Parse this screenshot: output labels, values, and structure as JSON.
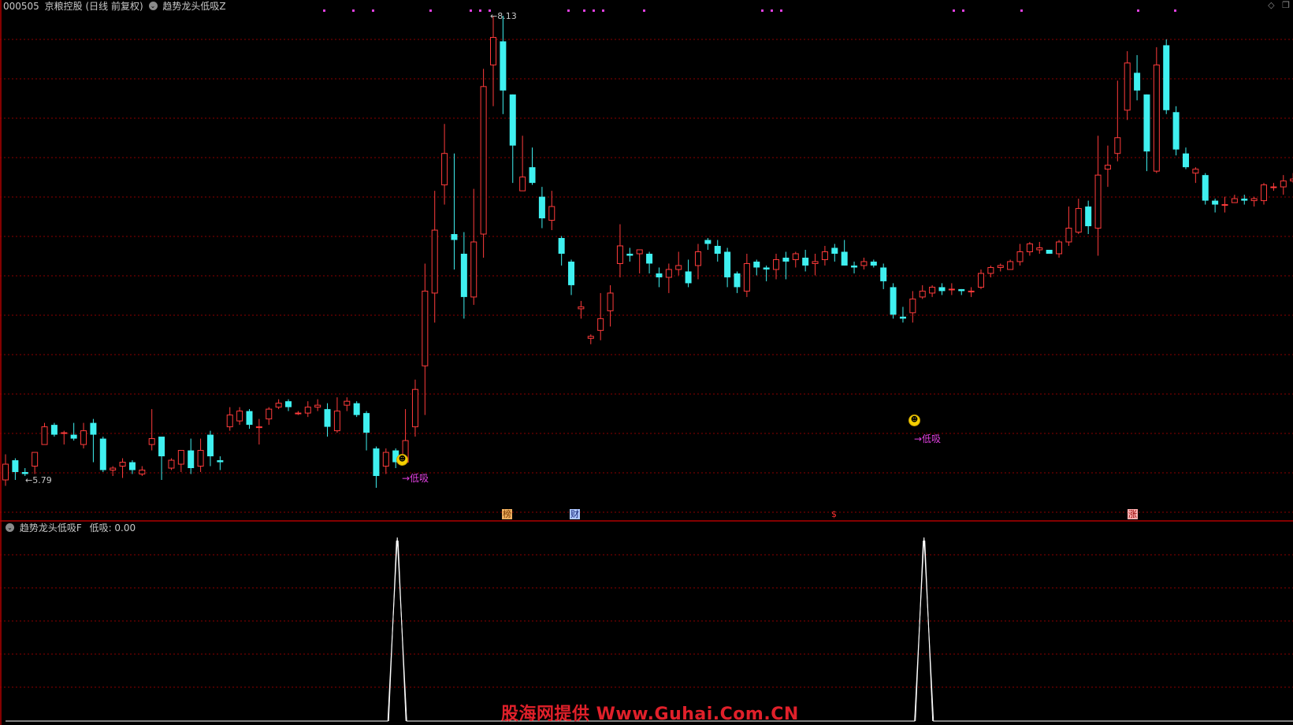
{
  "header": {
    "code": "000505",
    "name": "京粮控股",
    "period": "(日线 前复权)",
    "indicator": "趋势龙头低吸Z"
  },
  "sub_header": {
    "indicator": "趋势龙头低吸F",
    "value_label": "低吸: 0.00"
  },
  "top_right_icons": {
    "diamond": "◇",
    "window": "❐"
  },
  "price_labels": {
    "high": "8.13",
    "low": "5.79"
  },
  "signal_label": "→低吸",
  "event_tags": [
    "榜",
    "财",
    "$",
    "涨"
  ],
  "watermark": "股海网提供 Www.Guhai.Com.CN",
  "colors": {
    "up": "#ff3b3b",
    "down": "#3ff0f0",
    "grid": "#8b0000",
    "signal": "#e040e0",
    "divider": "#b00000"
  },
  "chart_data": {
    "type": "candlestick",
    "ylim": [
      5.55,
      8.3
    ],
    "candles": [
      [
        5.77,
        5.85,
        5.9,
        5.74
      ],
      [
        5.87,
        5.81,
        5.88,
        5.77
      ],
      [
        5.81,
        5.8,
        5.83,
        5.79
      ],
      [
        5.84,
        5.91,
        5.91,
        5.8
      ],
      [
        5.95,
        6.04,
        6.06,
        5.95
      ],
      [
        6.05,
        6.0,
        6.06,
        5.99
      ],
      [
        6.01,
        6.01,
        6.02,
        5.95
      ],
      [
        6.0,
        5.98,
        6.06,
        5.97
      ],
      [
        5.95,
        6.02,
        6.06,
        5.93
      ],
      [
        6.06,
        6.0,
        6.08,
        5.86
      ],
      [
        5.98,
        5.82,
        5.99,
        5.81
      ],
      [
        5.82,
        5.83,
        5.84,
        5.79
      ],
      [
        5.84,
        5.86,
        5.88,
        5.78
      ],
      [
        5.86,
        5.82,
        5.87,
        5.8
      ],
      [
        5.8,
        5.82,
        5.84,
        5.79
      ],
      [
        5.95,
        5.98,
        6.13,
        5.92
      ],
      [
        5.99,
        5.89,
        5.91,
        5.77
      ],
      [
        5.83,
        5.87,
        5.88,
        5.82
      ],
      [
        5.85,
        5.92,
        5.92,
        5.81
      ],
      [
        5.92,
        5.83,
        5.98,
        5.8
      ],
      [
        5.84,
        5.92,
        5.98,
        5.81
      ],
      [
        6.0,
        5.89,
        6.02,
        5.84
      ],
      [
        5.87,
        5.86,
        5.89,
        5.82
      ],
      [
        6.04,
        6.1,
        6.14,
        6.02
      ],
      [
        6.07,
        6.12,
        6.14,
        6.05
      ],
      [
        6.12,
        6.05,
        6.13,
        6.03
      ],
      [
        6.04,
        6.04,
        6.08,
        5.95
      ],
      [
        6.08,
        6.13,
        6.14,
        6.05
      ],
      [
        6.14,
        6.16,
        6.18,
        6.13
      ],
      [
        6.17,
        6.14,
        6.18,
        6.12
      ],
      [
        6.11,
        6.11,
        6.12,
        6.1
      ],
      [
        6.11,
        6.14,
        6.17,
        6.09
      ],
      [
        6.14,
        6.15,
        6.18,
        6.12
      ],
      [
        6.13,
        6.04,
        6.16,
        5.99
      ],
      [
        6.02,
        6.12,
        6.19,
        6.01
      ],
      [
        6.15,
        6.17,
        6.19,
        6.12
      ],
      [
        6.16,
        6.1,
        6.17,
        6.09
      ],
      [
        6.11,
        6.01,
        6.12,
        5.92
      ],
      [
        5.93,
        5.79,
        5.94,
        5.73
      ],
      [
        5.84,
        5.91,
        5.93,
        5.8
      ],
      [
        5.92,
        5.86,
        5.93,
        5.83
      ],
      [
        5.86,
        5.97,
        6.13,
        5.87
      ],
      [
        6.04,
        6.23,
        6.28,
        5.99
      ],
      [
        6.35,
        6.73,
        6.87,
        6.1
      ],
      [
        6.72,
        7.04,
        7.24,
        6.57
      ],
      [
        7.27,
        7.43,
        7.58,
        7.17
      ],
      [
        7.02,
        6.99,
        7.43,
        6.84
      ],
      [
        6.92,
        6.7,
        7.03,
        6.59
      ],
      [
        6.7,
        6.98,
        7.25,
        6.66
      ],
      [
        7.02,
        7.77,
        7.86,
        6.9
      ],
      [
        7.88,
        8.02,
        8.13,
        7.67
      ],
      [
        8.0,
        7.75,
        8.13,
        7.63
      ],
      [
        7.73,
        7.47,
        7.73,
        7.28
      ],
      [
        7.24,
        7.31,
        7.52,
        7.24
      ],
      [
        7.36,
        7.28,
        7.46,
        7.27
      ],
      [
        7.21,
        7.1,
        7.26,
        7.05
      ],
      [
        7.09,
        7.16,
        7.24,
        7.04
      ],
      [
        7.0,
        6.92,
        7.01,
        6.86
      ],
      [
        6.88,
        6.76,
        6.89,
        6.71
      ],
      [
        6.64,
        6.65,
        6.68,
        6.59
      ],
      [
        6.49,
        6.5,
        6.51,
        6.46
      ],
      [
        6.53,
        6.59,
        6.72,
        6.48
      ],
      [
        6.63,
        6.72,
        6.76,
        6.55
      ],
      [
        6.87,
        6.96,
        7.07,
        6.8
      ],
      [
        6.92,
        6.91,
        6.95,
        6.88
      ],
      [
        6.92,
        6.94,
        6.94,
        6.82
      ],
      [
        6.92,
        6.87,
        6.93,
        6.82
      ],
      [
        6.82,
        6.8,
        6.85,
        6.75
      ],
      [
        6.8,
        6.84,
        6.87,
        6.72
      ],
      [
        6.84,
        6.86,
        6.93,
        6.81
      ],
      [
        6.83,
        6.77,
        6.89,
        6.75
      ],
      [
        6.86,
        6.93,
        6.97,
        6.79
      ],
      [
        6.99,
        6.97,
        7.0,
        6.94
      ],
      [
        6.96,
        6.92,
        6.99,
        6.88
      ],
      [
        6.93,
        6.8,
        6.95,
        6.75
      ],
      [
        6.82,
        6.75,
        6.83,
        6.72
      ],
      [
        6.73,
        6.87,
        6.92,
        6.7
      ],
      [
        6.88,
        6.85,
        6.89,
        6.81
      ],
      [
        6.85,
        6.84,
        6.86,
        6.78
      ],
      [
        6.84,
        6.89,
        6.92,
        6.79
      ],
      [
        6.9,
        6.88,
        6.93,
        6.79
      ],
      [
        6.89,
        6.92,
        6.93,
        6.85
      ],
      [
        6.9,
        6.86,
        6.94,
        6.83
      ],
      [
        6.87,
        6.88,
        6.92,
        6.81
      ],
      [
        6.89,
        6.93,
        6.96,
        6.86
      ],
      [
        6.95,
        6.92,
        6.97,
        6.88
      ],
      [
        6.93,
        6.86,
        6.99,
        6.86
      ],
      [
        6.86,
        6.85,
        6.88,
        6.82
      ],
      [
        6.86,
        6.88,
        6.9,
        6.84
      ],
      [
        6.88,
        6.86,
        6.89,
        6.85
      ],
      [
        6.85,
        6.78,
        6.87,
        6.74
      ],
      [
        6.75,
        6.61,
        6.77,
        6.59
      ],
      [
        6.6,
        6.59,
        6.65,
        6.57
      ],
      [
        6.62,
        6.69,
        6.73,
        6.57
      ],
      [
        6.7,
        6.73,
        6.76,
        6.69
      ],
      [
        6.72,
        6.75,
        6.76,
        6.7
      ],
      [
        6.75,
        6.73,
        6.77,
        6.71
      ],
      [
        6.74,
        6.74,
        6.77,
        6.71
      ],
      [
        6.74,
        6.73,
        6.74,
        6.71
      ],
      [
        6.73,
        6.73,
        6.75,
        6.7
      ],
      [
        6.75,
        6.82,
        6.84,
        6.74
      ],
      [
        6.82,
        6.85,
        6.86,
        6.8
      ],
      [
        6.85,
        6.86,
        6.87,
        6.83
      ],
      [
        6.84,
        6.88,
        6.89,
        6.84
      ],
      [
        6.88,
        6.93,
        6.97,
        6.86
      ],
      [
        6.93,
        6.97,
        6.98,
        6.91
      ],
      [
        6.94,
        6.95,
        6.98,
        6.92
      ],
      [
        6.94,
        6.92,
        6.94,
        6.92
      ],
      [
        6.92,
        6.98,
        6.99,
        6.9
      ],
      [
        6.98,
        7.05,
        7.16,
        6.96
      ],
      [
        7.03,
        7.15,
        7.2,
        7.02
      ],
      [
        7.16,
        7.06,
        7.19,
        7.02
      ],
      [
        7.05,
        7.32,
        7.52,
        6.91
      ],
      [
        7.35,
        7.37,
        7.47,
        7.26
      ],
      [
        7.43,
        7.51,
        7.8,
        7.39
      ],
      [
        7.65,
        7.89,
        7.95,
        7.6
      ],
      [
        7.84,
        7.75,
        7.93,
        7.7
      ],
      [
        7.73,
        7.44,
        7.73,
        7.34
      ],
      [
        7.34,
        7.88,
        7.97,
        7.33
      ],
      [
        7.98,
        7.65,
        8.01,
        7.63
      ],
      [
        7.64,
        7.45,
        7.67,
        7.42
      ],
      [
        7.43,
        7.36,
        7.46,
        7.35
      ],
      [
        7.33,
        7.35,
        7.36,
        7.28
      ],
      [
        7.32,
        7.19,
        7.33,
        7.17
      ],
      [
        7.19,
        7.17,
        7.2,
        7.13
      ],
      [
        7.17,
        7.17,
        7.21,
        7.13
      ],
      [
        7.18,
        7.2,
        7.22,
        7.18
      ],
      [
        7.2,
        7.19,
        7.22,
        7.17
      ],
      [
        7.19,
        7.2,
        7.21,
        7.16
      ],
      [
        7.19,
        7.27,
        7.28,
        7.17
      ],
      [
        7.26,
        7.26,
        7.28,
        7.24
      ],
      [
        7.26,
        7.29,
        7.32,
        7.22
      ],
      [
        7.29,
        7.3,
        7.33,
        7.28
      ]
    ],
    "signals": [
      {
        "index": 40,
        "label": "→低吸"
      },
      {
        "index": 94,
        "label": "→低吸"
      }
    ],
    "subchart": {
      "series_name": "低吸",
      "current_value": 0.0,
      "peaks_at_index": [
        40,
        94
      ],
      "peak_value": 1
    }
  }
}
